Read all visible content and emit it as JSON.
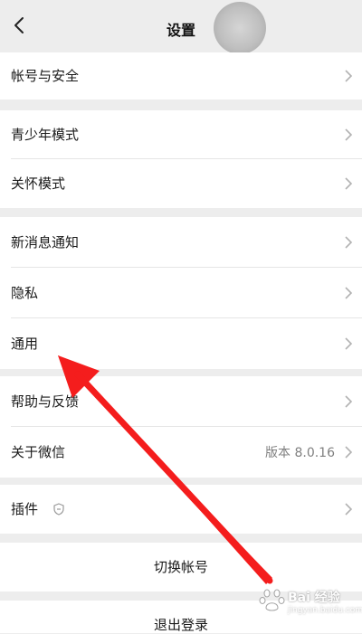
{
  "nav": {
    "title": "设置",
    "back_icon": "chevron-left-icon"
  },
  "sections": [
    {
      "items": [
        {
          "label": "帐号与安全"
        }
      ]
    },
    {
      "items": [
        {
          "label": "青少年模式"
        },
        {
          "label": "关怀模式"
        }
      ]
    },
    {
      "items": [
        {
          "label": "新消息通知"
        },
        {
          "label": "隐私"
        },
        {
          "label": "通用"
        }
      ]
    },
    {
      "items": [
        {
          "label": "帮助与反馈"
        },
        {
          "label": "关于微信",
          "value": "版本 8.0.16"
        }
      ]
    },
    {
      "items": [
        {
          "label": "插件",
          "icon": "plugin-shield-icon"
        }
      ]
    }
  ],
  "actions": {
    "switch_account": "切换帐号",
    "logout": "退出登录"
  },
  "watermark": {
    "text": "Bai 经验",
    "sub": "jingyan.baidu.com"
  },
  "colors": {
    "background": "#ededed",
    "row": "#ffffff",
    "arrow": "#f41d1d",
    "secondary_text": "#7f7f7f"
  }
}
